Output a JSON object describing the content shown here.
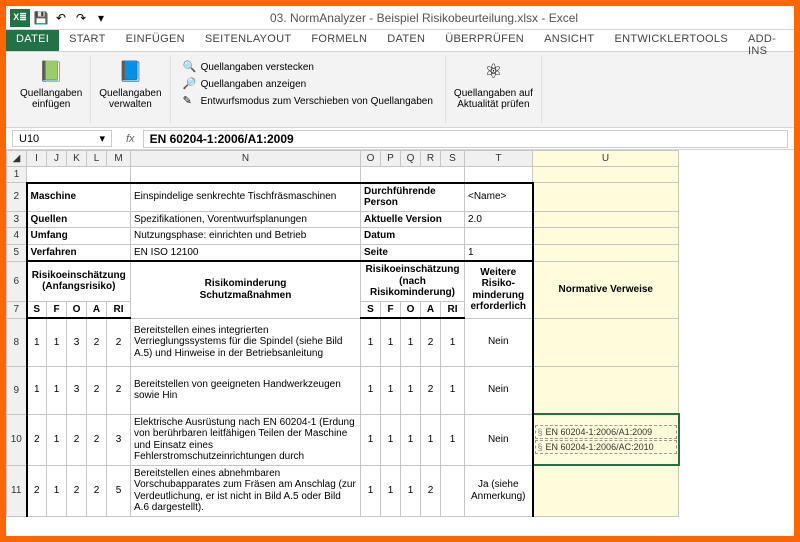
{
  "app": {
    "title": "03. NormAnalyzer - Beispiel Risikobeurteilung.xlsx - Excel"
  },
  "qat": {
    "save": "💾",
    "undo": "↶",
    "redo": "↷",
    "more": "▾"
  },
  "tabs": [
    "DATEI",
    "START",
    "EINFÜGEN",
    "SEITENLAYOUT",
    "FORMELN",
    "DATEN",
    "ÜBERPRÜFEN",
    "ANSICHT",
    "ENTWICKLERTOOLS",
    "ADD-INS"
  ],
  "ribbon": {
    "einfuegen": "Quellangaben\neinfügen",
    "verwalten": "Quellangaben\nverwalten",
    "verstecken": "Quellangaben verstecken",
    "anzeigen": "Quellangaben anzeigen",
    "entwurf": "Entwurfsmodus zum Verschieben von Quellangaben",
    "aktualitaet": "Quellangaben auf\nAktualität prüfen"
  },
  "namebox": "U10",
  "formula": "EN 60204-1:2006/A1:2009",
  "cols": [
    "I",
    "J",
    "K",
    "L",
    "M",
    "N",
    "O",
    "P",
    "Q",
    "R",
    "S",
    "T",
    "U"
  ],
  "meta": {
    "r2l": "Maschine",
    "r2n": "Einspindelige senkrechte Tischfräsmaschinen",
    "r2o": "Durchführende Person",
    "r2t": "<Name>",
    "r3l": "Quellen",
    "r3n": "Spezifikationen, Vorentwurfsplanungen",
    "r3o": "Aktuelle Version",
    "r3t": "2.0",
    "r4l": "Umfang",
    "r4n": "Nutzungsphase: einrichten und Betrieb",
    "r4o": "Datum",
    "r4t": "",
    "r5l": "Verfahren",
    "r5n": "EN ISO 12100",
    "r5o": "Seite",
    "r5t": "1"
  },
  "hdr": {
    "risk1": "Risikoeinschätzung\n(Anfangsrisiko)",
    "riskmind": "Risikominderung\nSchutzmaßnahmen",
    "risk2": "Risikoeinschätzung\n(nach Risikominderung)",
    "weitere": "Weitere Risiko-\nminderung erforderlich",
    "norm": "Normative Verweise",
    "S": "S",
    "F": "F",
    "O": "O",
    "A": "A",
    "RI": "RI"
  },
  "rows": [
    {
      "s1": "1",
      "f1": "1",
      "o1": "3",
      "a1": "2",
      "ri1": "2",
      "txt": "Bereitstellen eines integrierten Verrieglungssystems für die Spindel (siehe Bild A.5) und Hinweise in der Betriebsanleitung",
      "s2": "1",
      "f2": "1",
      "o2": "1",
      "a2": "2",
      "ri2": "1",
      "w": "Nein",
      "norm": []
    },
    {
      "s1": "1",
      "f1": "1",
      "o1": "3",
      "a1": "2",
      "ri1": "2",
      "txt": "Bereitstellen von geeigneten Handwerkzeugen sowie Hin",
      "s2": "1",
      "f2": "1",
      "o2": "1",
      "a2": "2",
      "ri2": "1",
      "w": "Nein",
      "norm": []
    },
    {
      "s1": "2",
      "f1": "1",
      "o1": "2",
      "a1": "2",
      "ri1": "3",
      "txt": "Elektrische Ausrüstung nach EN 60204-1 (Erdung von berührbaren leitfähigen Teilen der Maschine und Einsatz eines Fehlerstromschutzeinrichtungen durch",
      "s2": "1",
      "f2": "1",
      "o2": "1",
      "a2": "1",
      "ri2": "1",
      "w": "Nein",
      "norm": [
        "EN 60204-1:2006/A1:2009",
        "EN 60204-1:2006/AC:2010"
      ]
    },
    {
      "s1": "2",
      "f1": "1",
      "o1": "2",
      "a1": "2",
      "ri1": "5",
      "txt": "Bereitstellen eines abnehmbaren Vorschubapparates zum Fräsen am Anschlag (zur Verdeutlichung, er ist nicht in Bild A.5 oder Bild A.6 dargestellt).",
      "s2": "1",
      "f2": "1",
      "o2": "1",
      "a2": "2",
      "ri2": "",
      "w": "Ja (siehe Anmerkung)",
      "norm": []
    }
  ]
}
